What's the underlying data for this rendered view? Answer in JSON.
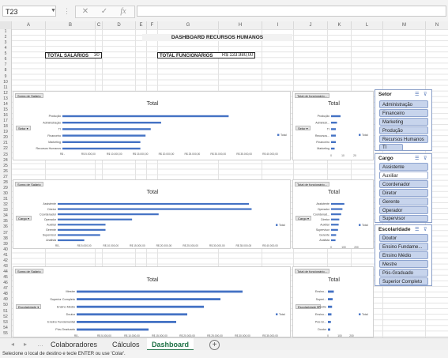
{
  "formula_bar": {
    "name_box": "T23",
    "cancel_icon": "✕",
    "enter_icon": "✓",
    "fx_label": "fx"
  },
  "columns": [
    "A",
    "B",
    "C",
    "D",
    "E",
    "F",
    "G",
    "H",
    "I",
    "J",
    "K",
    "L",
    "M",
    "N"
  ],
  "rows": [
    "1",
    "2",
    "3",
    "4",
    "5",
    "6",
    "7",
    "8",
    "9",
    "10",
    "11",
    "12",
    "13",
    "14",
    "15",
    "16",
    "17",
    "18",
    "19",
    "20",
    "21",
    "22",
    "23",
    "24",
    "25",
    "26",
    "27",
    "28",
    "29",
    "30",
    "31",
    "32",
    "33",
    "34",
    "35",
    "36",
    "37",
    "38",
    "39",
    "40",
    "41",
    "42",
    "43",
    "44",
    "45",
    "46",
    "47",
    "48",
    "49",
    "50",
    "51",
    "52",
    "53",
    "54",
    "55"
  ],
  "sheet": {
    "title": "DASHBOARD RECURSOS HUMANOS",
    "total_salarios_label": "TOTAL SALÁRIOS",
    "total_salarios_value": "30",
    "total_funcionarios_label": "TOTAL FUNCIONÁRIOS",
    "total_funcionarios_value": "R$ 133.980,00"
  },
  "colors": {
    "bar": "#4472c4",
    "slicer_item": "#c7d4ec",
    "active_tab": "#1e7145"
  },
  "pivot": {
    "soma_salario": "Soma de Salário",
    "total_func": "Total de funcionário...",
    "chart_title": "Total",
    "legend": "Total"
  },
  "chart_data": [
    {
      "type": "bar",
      "title": "Total",
      "field": "Setor",
      "categories": [
        "Produção",
        "Administração",
        "TI",
        "Financeiro",
        "Marketing",
        "Recursos Humanos"
      ],
      "values": [
        32000,
        19000,
        17000,
        16000,
        15000,
        15000
      ],
      "xticks": [
        "R$ -",
        "R$ 5.000,00",
        "R$ 10.000,00",
        "R$ 15.000,00",
        "R$ 20.000,00",
        "R$ 25.000,00",
        "R$ 30.000,00",
        "R$ 35.000,00",
        "R$ 40.000,00"
      ],
      "xlim": [
        0,
        40000
      ]
    },
    {
      "type": "bar",
      "title": "Total",
      "field": "Setor",
      "categories": [
        "Produção",
        "Administr...",
        "TI",
        "Recursos...",
        "Financeiro",
        "Marketing"
      ],
      "values": [
        8,
        5,
        4,
        4,
        4,
        3
      ],
      "xticks": [
        "0",
        "10",
        "20"
      ],
      "xlim": [
        0,
        20
      ]
    },
    {
      "type": "bar",
      "title": "Total",
      "field": "Cargo",
      "categories": [
        "Assistente",
        "Diretor",
        "Coordenador",
        "Operador",
        "Auxiliar",
        "Gerente",
        "Supervisor",
        "Analista"
      ],
      "values": [
        36000,
        36500,
        19000,
        14000,
        9000,
        9000,
        8000,
        5000
      ],
      "xticks": [
        "R$ -",
        "R$ 5.000,00",
        "R$ 10.000,00",
        "R$ 15.000,00",
        "R$ 20.000,00",
        "R$ 25.000,00",
        "R$ 30.000,00",
        "R$ 35.000,00",
        "R$ 40.000,00"
      ],
      "xlim": [
        0,
        40000
      ]
    },
    {
      "type": "bar",
      "title": "Total",
      "field": "Cargo",
      "categories": [
        "Assistente",
        "Operador",
        "Coordenad...",
        "Diretor",
        "Auxiliar",
        "Supervisor",
        "Gerente",
        "Analista"
      ],
      "values": [
        105,
        90,
        80,
        65,
        60,
        55,
        40,
        35
      ],
      "xticks": [
        "0",
        "100",
        "200"
      ],
      "xlim": [
        0,
        200
      ]
    },
    {
      "type": "bar",
      "title": "Total",
      "field": "Escolaridade",
      "categories": [
        "Mestre",
        "Superior Completo",
        "Ensino Médio",
        "Doutor",
        "Ensino Fundamental",
        "Pós-Graduado"
      ],
      "values": [
        30000,
        26000,
        23000,
        20000,
        18000,
        13000
      ],
      "xticks": [
        "R$ -",
        "R$ 5.000,00",
        "R$ 10.000,00",
        "R$ 15.000,00",
        "R$ 20.000,00",
        "R$ 25.000,00",
        "R$ 30.000,00",
        "R$ 35.000,00"
      ],
      "xlim": [
        0,
        35000
      ]
    },
    {
      "type": "bar",
      "title": "Total",
      "field": "Escolaridade",
      "categories": [
        "Ensino...",
        "Superi...",
        "Mestre",
        "Ensino...",
        "Pós-Gr...",
        "Doutor"
      ],
      "values": [
        50,
        40,
        35,
        30,
        25,
        20
      ],
      "xticks": [
        "0",
        "100",
        "200"
      ],
      "xlim": [
        0,
        200
      ]
    }
  ],
  "slicers": [
    {
      "title": "Setor",
      "items": [
        {
          "label": "Administração",
          "selected": true
        },
        {
          "label": "Financeiro",
          "selected": true
        },
        {
          "label": "Marketing",
          "selected": true
        },
        {
          "label": "Produção",
          "selected": true
        },
        {
          "label": "Recursos Humanos",
          "selected": true
        },
        {
          "label": "TI",
          "selected": true
        }
      ]
    },
    {
      "title": "Cargo",
      "items": [
        {
          "label": "Assistente",
          "selected": true
        },
        {
          "label": "Auxiliar",
          "selected": false
        },
        {
          "label": "Coordenador",
          "selected": true
        },
        {
          "label": "Diretor",
          "selected": true
        },
        {
          "label": "Gerente",
          "selected": true
        },
        {
          "label": "Operador",
          "selected": true
        },
        {
          "label": "Supervisor",
          "selected": true
        }
      ]
    },
    {
      "title": "Escolaridade",
      "items": [
        {
          "label": "Doutor",
          "selected": true
        },
        {
          "label": "Ensino Fundame...",
          "selected": true
        },
        {
          "label": "Ensino Médio",
          "selected": true
        },
        {
          "label": "Mestre",
          "selected": true
        },
        {
          "label": "Pós-Graduado",
          "selected": true
        },
        {
          "label": "Superior Completo",
          "selected": true
        }
      ]
    }
  ],
  "tabs": [
    {
      "label": "Colaboradores",
      "active": false
    },
    {
      "label": "Cálculos",
      "active": false
    },
    {
      "label": "Dashboard",
      "active": true
    }
  ],
  "status": "Selecione o local de destino e tecle ENTER ou use 'Colar'."
}
